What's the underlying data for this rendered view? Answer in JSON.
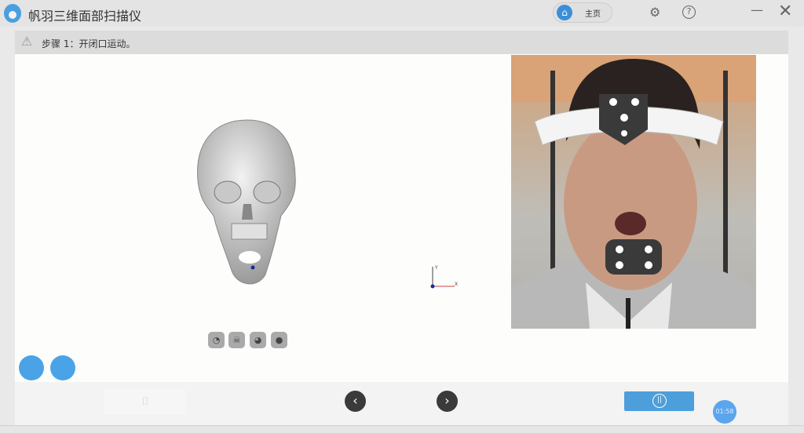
{
  "app": {
    "title": "帆羽三维面部扫描仪",
    "home_label": "主页"
  },
  "step": {
    "text": "步骤 1：开闭口运动。"
  },
  "axes": {
    "x": "X",
    "y": "Y"
  },
  "footer": {
    "timer": "01:58"
  },
  "colors": {
    "accent": "#4c9fdb",
    "dots": "#4aa3e6"
  }
}
